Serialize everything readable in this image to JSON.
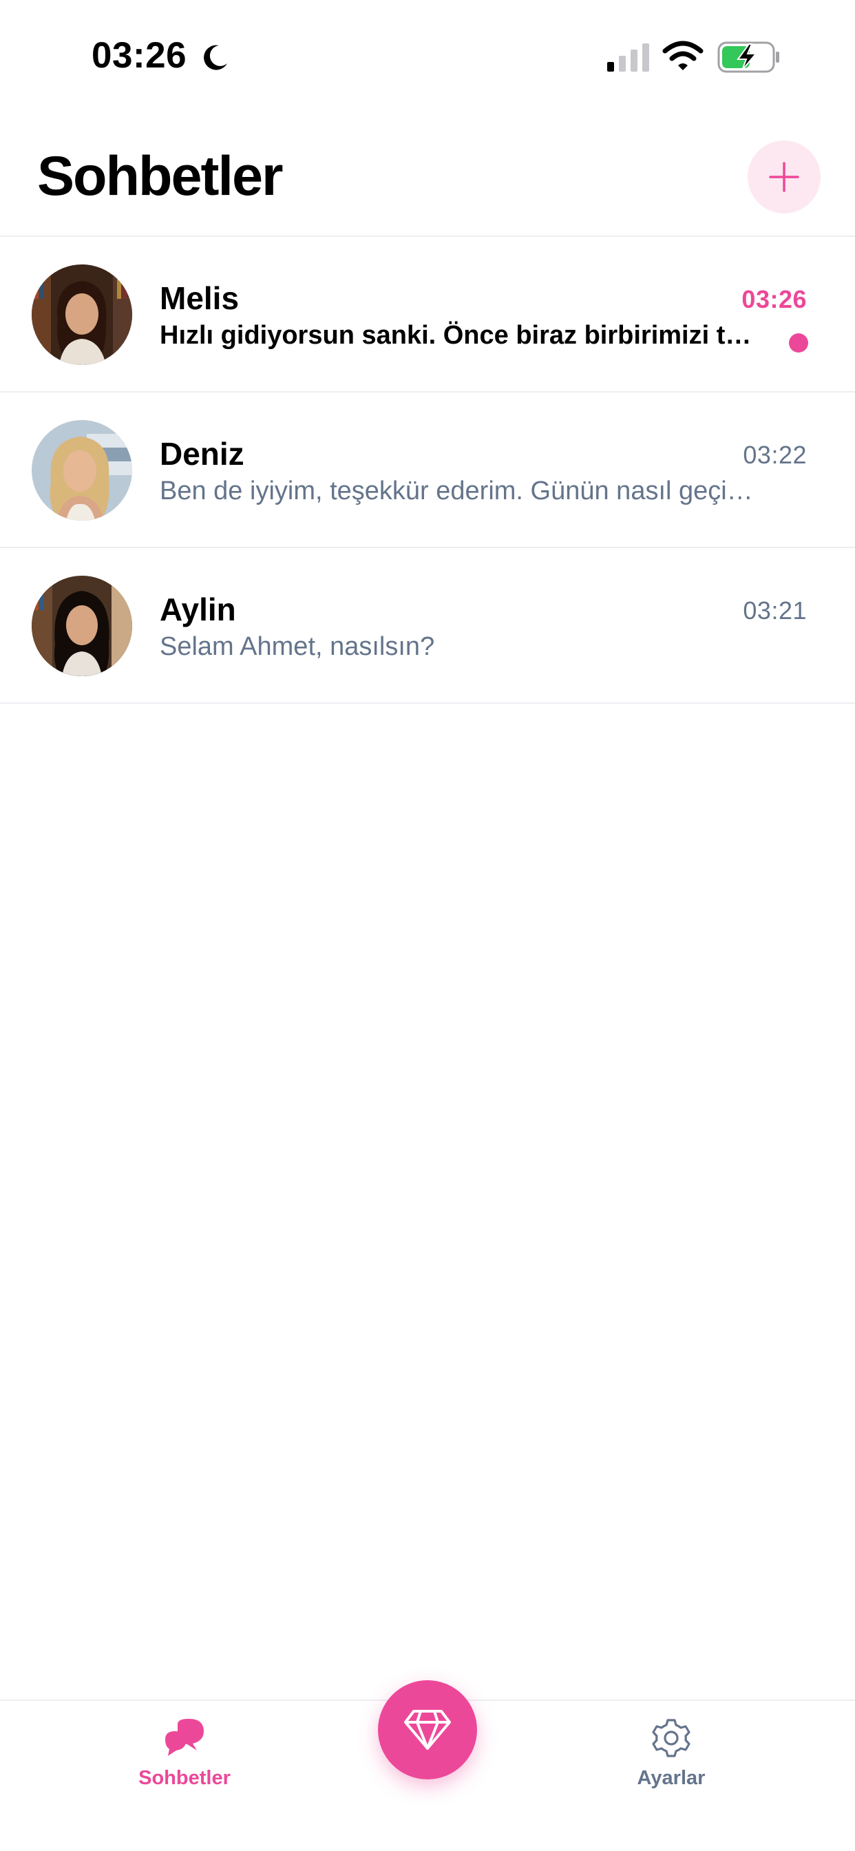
{
  "status_bar": {
    "time": "03:26",
    "icons": [
      "moon-icon",
      "signal-icon",
      "wifi-icon",
      "battery-charging-icon"
    ]
  },
  "header": {
    "title": "Sohbetler",
    "new_chat_icon": "plus-icon"
  },
  "chats": [
    {
      "name": "Melis",
      "time": "03:26",
      "preview": "Hızlı gidiyorsun sanki. Önce biraz birbirimizi tanıyalım",
      "unread": true
    },
    {
      "name": "Deniz",
      "time": "03:22",
      "preview": "Ben de iyiyim, teşekkür ederim. Günün nasıl geçiyor?",
      "unread": false
    },
    {
      "name": "Aylin",
      "time": "03:21",
      "preview": "Selam Ahmet, nasılsın?",
      "unread": false
    }
  ],
  "tab_bar": {
    "chats_label": "Sohbetler",
    "settings_label": "Ayarlar",
    "premium_icon": "diamond-icon"
  },
  "colors": {
    "accent": "#ec4899",
    "accent_light": "#fde8f1",
    "muted_text": "#64748b",
    "divider": "#eceef2"
  }
}
